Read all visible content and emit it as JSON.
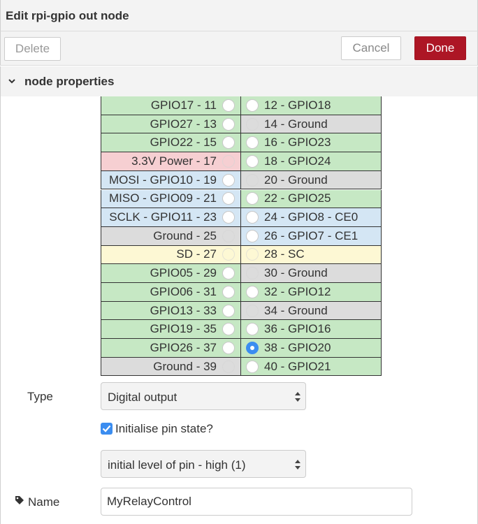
{
  "header": {
    "title": "Edit rpi-gpio out node"
  },
  "toolbar": {
    "delete_label": "Delete",
    "cancel_label": "Cancel",
    "done_label": "Done"
  },
  "section": {
    "label": "node properties",
    "icon": "chevron-down-icon"
  },
  "pins": [
    {
      "left": "GPIO17 - 11",
      "left_color": "green",
      "left_enabled": true,
      "right": "12 - GPIO18",
      "right_color": "green",
      "right_enabled": true
    },
    {
      "left": "GPIO27 - 13",
      "left_color": "green",
      "left_enabled": true,
      "right": "14 - Ground",
      "right_color": "grey",
      "right_enabled": false
    },
    {
      "left": "GPIO22 - 15",
      "left_color": "green",
      "left_enabled": true,
      "right": "16 - GPIO23",
      "right_color": "green",
      "right_enabled": true
    },
    {
      "left": "3.3V Power - 17",
      "left_color": "red",
      "left_enabled": false,
      "right": "18 - GPIO24",
      "right_color": "green",
      "right_enabled": true
    },
    {
      "left": "MOSI - GPIO10 - 19",
      "left_color": "blue",
      "left_enabled": true,
      "right": "20 - Ground",
      "right_color": "grey",
      "right_enabled": false
    },
    {
      "left": "MISO - GPIO09 - 21",
      "left_color": "blue",
      "left_enabled": true,
      "right": "22 - GPIO25",
      "right_color": "green",
      "right_enabled": true
    },
    {
      "left": "SCLK - GPIO11 - 23",
      "left_color": "blue",
      "left_enabled": true,
      "right": "24 - GPIO8 - CE0",
      "right_color": "blue",
      "right_enabled": true
    },
    {
      "left": "Ground - 25",
      "left_color": "grey",
      "left_enabled": false,
      "right": "26 - GPIO7 - CE1",
      "right_color": "blue",
      "right_enabled": true
    },
    {
      "left": "SD - 27",
      "left_color": "yellow",
      "left_enabled": false,
      "right": "28 - SC",
      "right_color": "yellow",
      "right_enabled": false
    },
    {
      "left": "GPIO05 - 29",
      "left_color": "green",
      "left_enabled": true,
      "right": "30 - Ground",
      "right_color": "grey",
      "right_enabled": false
    },
    {
      "left": "GPIO06 - 31",
      "left_color": "green",
      "left_enabled": true,
      "right": "32 - GPIO12",
      "right_color": "green",
      "right_enabled": true
    },
    {
      "left": "GPIO13 - 33",
      "left_color": "green",
      "left_enabled": true,
      "right": "34 - Ground",
      "right_color": "grey",
      "right_enabled": false
    },
    {
      "left": "GPIO19 - 35",
      "left_color": "green",
      "left_enabled": true,
      "right": "36 - GPIO16",
      "right_color": "green",
      "right_enabled": true
    },
    {
      "left": "GPIO26 - 37",
      "left_color": "green",
      "left_enabled": true,
      "right": "38 - GPIO20",
      "right_color": "green",
      "right_enabled": true,
      "right_selected": true
    },
    {
      "left": "Ground - 39",
      "left_color": "grey",
      "left_enabled": false,
      "right": "40 - GPIO21",
      "right_color": "green",
      "right_enabled": true
    }
  ],
  "type_field": {
    "label": "Type",
    "value": "Digital output"
  },
  "init_state": {
    "label": "Initialise pin state?",
    "checked": true
  },
  "level_field": {
    "value": "initial level of pin - high (1)"
  },
  "name_field": {
    "label": "Name",
    "value": "MyRelayControl",
    "icon": "tag-icon"
  },
  "colors": {
    "accent": "#3b8df0",
    "done_button": "#ad1625",
    "green": "#c6e8c4",
    "grey": "#dcdcdc",
    "red": "#f6cfd2",
    "blue": "#d4e6f4",
    "yellow": "#fdf8d4"
  }
}
